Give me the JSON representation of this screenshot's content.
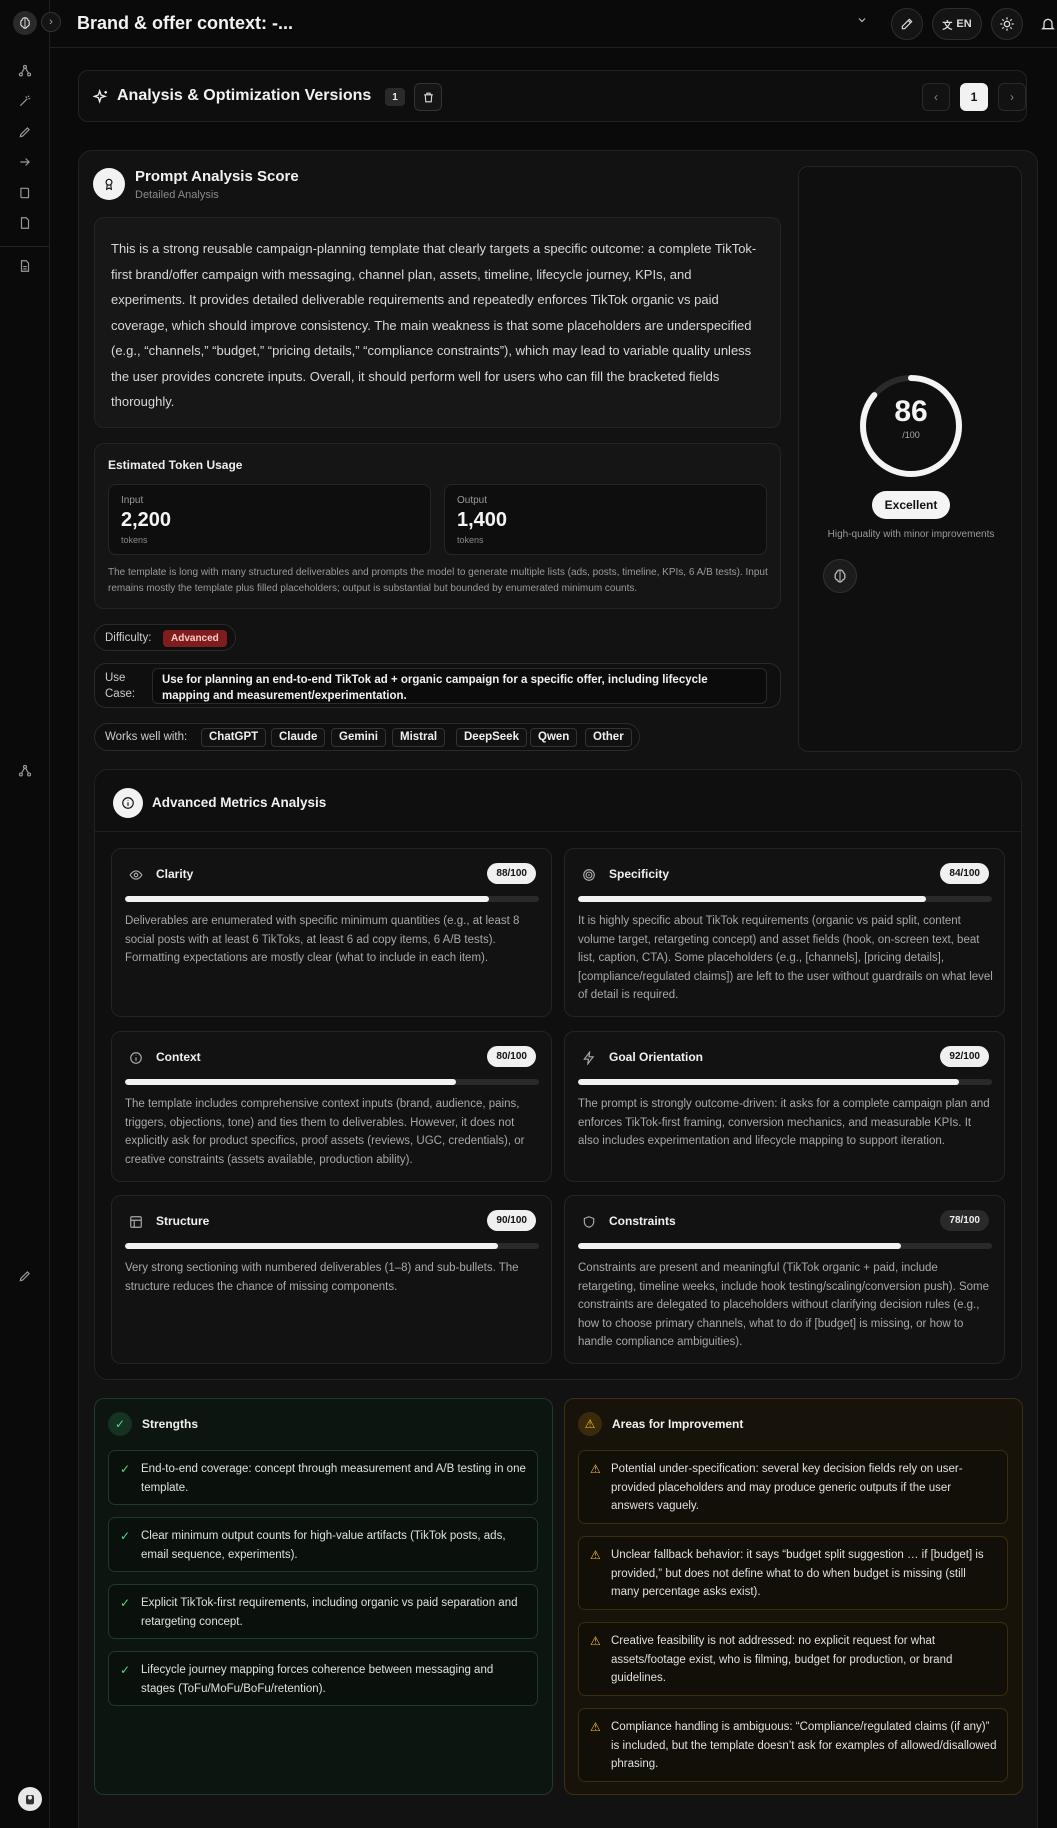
{
  "header": {
    "title": "Brand & offer context: -...",
    "language": "EN"
  },
  "versions": {
    "title": "Analysis & Optimization Versions",
    "count": "1",
    "current_page": "1"
  },
  "analysis": {
    "title": "Prompt Analysis Score",
    "subtitle": "Detailed Analysis",
    "summary": "This is a strong reusable campaign-planning template that clearly targets a specific outcome: a complete TikTok-first brand/offer campaign with messaging, channel plan, assets, timeline, lifecycle journey, KPIs, and experiments. It provides detailed deliverable requirements and repeatedly enforces TikTok organic vs paid coverage, which should improve consistency. The main weakness is that some placeholders are underspecified (e.g., “channels,” “budget,” “pricing details,” “compliance constraints”), which may lead to variable quality unless the user provides concrete inputs. Overall, it should perform well for users who can fill the bracketed fields thoroughly.",
    "tokens": {
      "title": "Estimated Token Usage",
      "input_label": "Input",
      "input_value": "2,200",
      "output_label": "Output",
      "output_value": "1,400",
      "unit": "tokens",
      "note": "The template is long with many structured deliverables and prompts the model to generate multiple lists (ads, posts, timeline, KPIs, 6 A/B tests). Input remains mostly the template plus filled placeholders; output is substantial but bounded by enumerated minimum counts."
    },
    "difficulty_label": "Difficulty:",
    "difficulty_value": "Advanced",
    "use_case_label": "Use Case:",
    "use_case_value": "Use for planning an end-to-end TikTok ad + organic campaign for a specific offer, including lifecycle mapping and measurement/experimentation.",
    "works_label": "Works well with:",
    "models": [
      "ChatGPT",
      "Claude",
      "Gemini",
      "Mistral",
      "DeepSeek",
      "Qwen",
      "Other"
    ]
  },
  "score": {
    "value": 86,
    "value_text": "86",
    "max_text": "/100",
    "grade": "Excellent",
    "note": "High-quality with minor improvements"
  },
  "metrics": {
    "title": "Advanced Metrics Analysis",
    "items": [
      {
        "name": "Clarity",
        "icon": "eye-icon",
        "score": 88,
        "score_text": "88/100",
        "desc": "Deliverables are enumerated with specific minimum quantities (e.g., at least 8 social posts with at least 6 TikToks, at least 6 ad copy items, 6 A/B tests). Formatting expectations are mostly clear (what to include in each item)."
      },
      {
        "name": "Specificity",
        "icon": "target-icon",
        "score": 84,
        "score_text": "84/100",
        "desc": "It is highly specific about TikTok requirements (organic vs paid split, content volume target, retargeting concept) and asset fields (hook, on-screen text, beat list, caption, CTA). Some placeholders (e.g., [channels], [pricing details], [compliance/regulated claims]) are left to the user without guardrails on what level of detail is required."
      },
      {
        "name": "Context",
        "icon": "info-icon",
        "score": 80,
        "score_text": "80/100",
        "desc": "The template includes comprehensive context inputs (brand, audience, pains, triggers, objections, tone) and ties them to deliverables. However, it does not explicitly ask for product specifics, proof assets (reviews, UGC, credentials), or creative constraints (assets available, production ability)."
      },
      {
        "name": "Goal Orientation",
        "icon": "bolt-icon",
        "score": 92,
        "score_text": "92/100",
        "desc": "The prompt is strongly outcome-driven: it asks for a complete campaign plan and enforces TikTok-first framing, conversion mechanics, and measurable KPIs. It also includes experimentation and lifecycle mapping to support iteration."
      },
      {
        "name": "Structure",
        "icon": "layout-icon",
        "score": 90,
        "score_text": "90/100",
        "desc": "Very strong sectioning with numbered deliverables (1–8) and sub-bullets. The structure reduces the chance of missing components."
      },
      {
        "name": "Constraints",
        "icon": "shield-icon",
        "score": 78,
        "score_text": "78/100",
        "desc": "Constraints are present and meaningful (TikTok organic + paid, include retargeting, timeline weeks, include hook testing/scaling/conversion push). Some constraints are delegated to placeholders without clarifying decision rules (e.g., how to choose primary channels, what to do if [budget] is missing, or how to handle compliance ambiguities)."
      }
    ]
  },
  "strengths": {
    "title": "Strengths",
    "items": [
      "End-to-end coverage: concept through measurement and A/B testing in one template.",
      "Clear minimum output counts for high-value artifacts (TikTok posts, ads, email sequence, experiments).",
      "Explicit TikTok-first requirements, including organic vs paid separation and retargeting concept.",
      "Lifecycle journey mapping forces coherence between messaging and stages (ToFu/MoFu/BoFu/retention)."
    ]
  },
  "improvements": {
    "title": "Areas for Improvement",
    "items": [
      "Potential under-specification: several key decision fields rely on user-provided placeholders and may produce generic outputs if the user answers vaguely.",
      "Unclear fallback behavior: it says “budget split suggestion … if [budget] is provided,” but does not define what to do when budget is missing (still many percentage asks exist).",
      "Creative feasibility is not addressed: no explicit request for what assets/footage exist, who is filming, budget for production, or brand guidelines.",
      "Compliance handling is ambiguous: “Compliance/regulated claims (if any)” is included, but the template doesn’t ask for examples of allowed/disallowed phrasing."
    ]
  },
  "colors": {
    "accent": "#f2f2f2",
    "advanced_badge": "#7f1d1d",
    "strength_check": "#4ade80",
    "warning": "#fbbf24"
  }
}
